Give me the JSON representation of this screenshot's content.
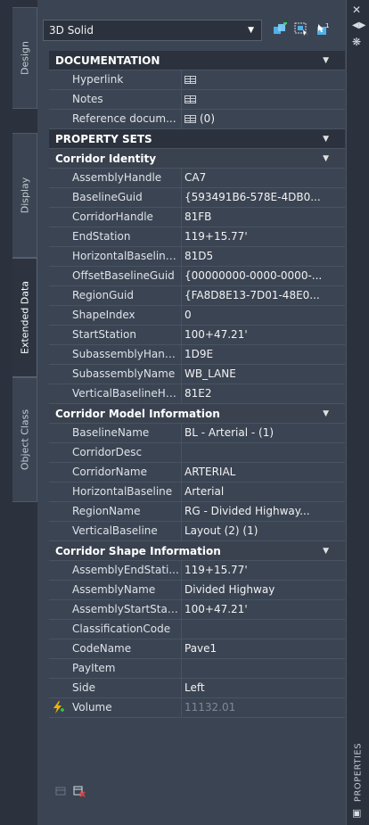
{
  "object_type": "3D Solid",
  "vtabs": [
    "Design",
    "Display",
    "Extended Data",
    "Object Class"
  ],
  "active_tab": "Extended Data",
  "palette_title": "PROPERTIES",
  "toolbar": {
    "icons": [
      "quick-select-icon",
      "select-objects-icon",
      "toggle-pickadd-icon"
    ]
  },
  "documentation": {
    "header": "DOCUMENTATION",
    "rows": [
      {
        "name": "Hyperlink",
        "value": "",
        "icon": "table-icon"
      },
      {
        "name": "Notes",
        "value": "",
        "icon": "table-icon"
      },
      {
        "name": "Reference docum...",
        "value": "(0)",
        "icon": "table-icon"
      }
    ]
  },
  "property_sets": {
    "header": "PROPERTY SETS",
    "groups": [
      {
        "name": "Corridor Identity",
        "rows": [
          {
            "name": "AssemblyHandle",
            "value": "CA7"
          },
          {
            "name": "BaselineGuid",
            "value": "{593491B6-578E-4DB0..."
          },
          {
            "name": "CorridorHandle",
            "value": "81FB"
          },
          {
            "name": "EndStation",
            "value": "119+15.77'"
          },
          {
            "name": "HorizontalBaseline...",
            "value": "81D5"
          },
          {
            "name": "OffsetBaselineGuid",
            "value": "{00000000-0000-0000-..."
          },
          {
            "name": "RegionGuid",
            "value": "{FA8D8E13-7D01-48E0..."
          },
          {
            "name": "ShapeIndex",
            "value": "0"
          },
          {
            "name": "StartStation",
            "value": "100+47.21'"
          },
          {
            "name": "SubassemblyHandle",
            "value": "1D9E"
          },
          {
            "name": "SubassemblyName",
            "value": "WB_LANE"
          },
          {
            "name": "VerticalBaselineHa...",
            "value": "81E2"
          }
        ]
      },
      {
        "name": "Corridor Model Information",
        "rows": [
          {
            "name": "BaselineName",
            "value": "BL - Arterial - (1)"
          },
          {
            "name": "CorridorDesc",
            "value": ""
          },
          {
            "name": "CorridorName",
            "value": "ARTERIAL"
          },
          {
            "name": "HorizontalBaseline",
            "value": "Arterial"
          },
          {
            "name": "RegionName",
            "value": "RG - Divided Highway..."
          },
          {
            "name": "VerticalBaseline",
            "value": "Layout (2) (1)"
          }
        ]
      },
      {
        "name": "Corridor Shape Information",
        "rows": [
          {
            "name": "AssemblyEndStati...",
            "value": "119+15.77'"
          },
          {
            "name": "AssemblyName",
            "value": "Divided Highway"
          },
          {
            "name": "AssemblyStartStati...",
            "value": "100+47.21'"
          },
          {
            "name": "ClassificationCode",
            "value": ""
          },
          {
            "name": "CodeName",
            "value": "Pave1"
          },
          {
            "name": "PayItem",
            "value": ""
          },
          {
            "name": "Side",
            "value": "Left"
          },
          {
            "name": "Volume",
            "value": "11132.01",
            "dim": true,
            "icon": "formula-bolt-icon"
          }
        ]
      }
    ]
  },
  "colors": {
    "panel": "#3b4453",
    "category": "#2b323d",
    "accent_bolt": "#f0b400",
    "accent_green": "#2fbf4a"
  }
}
